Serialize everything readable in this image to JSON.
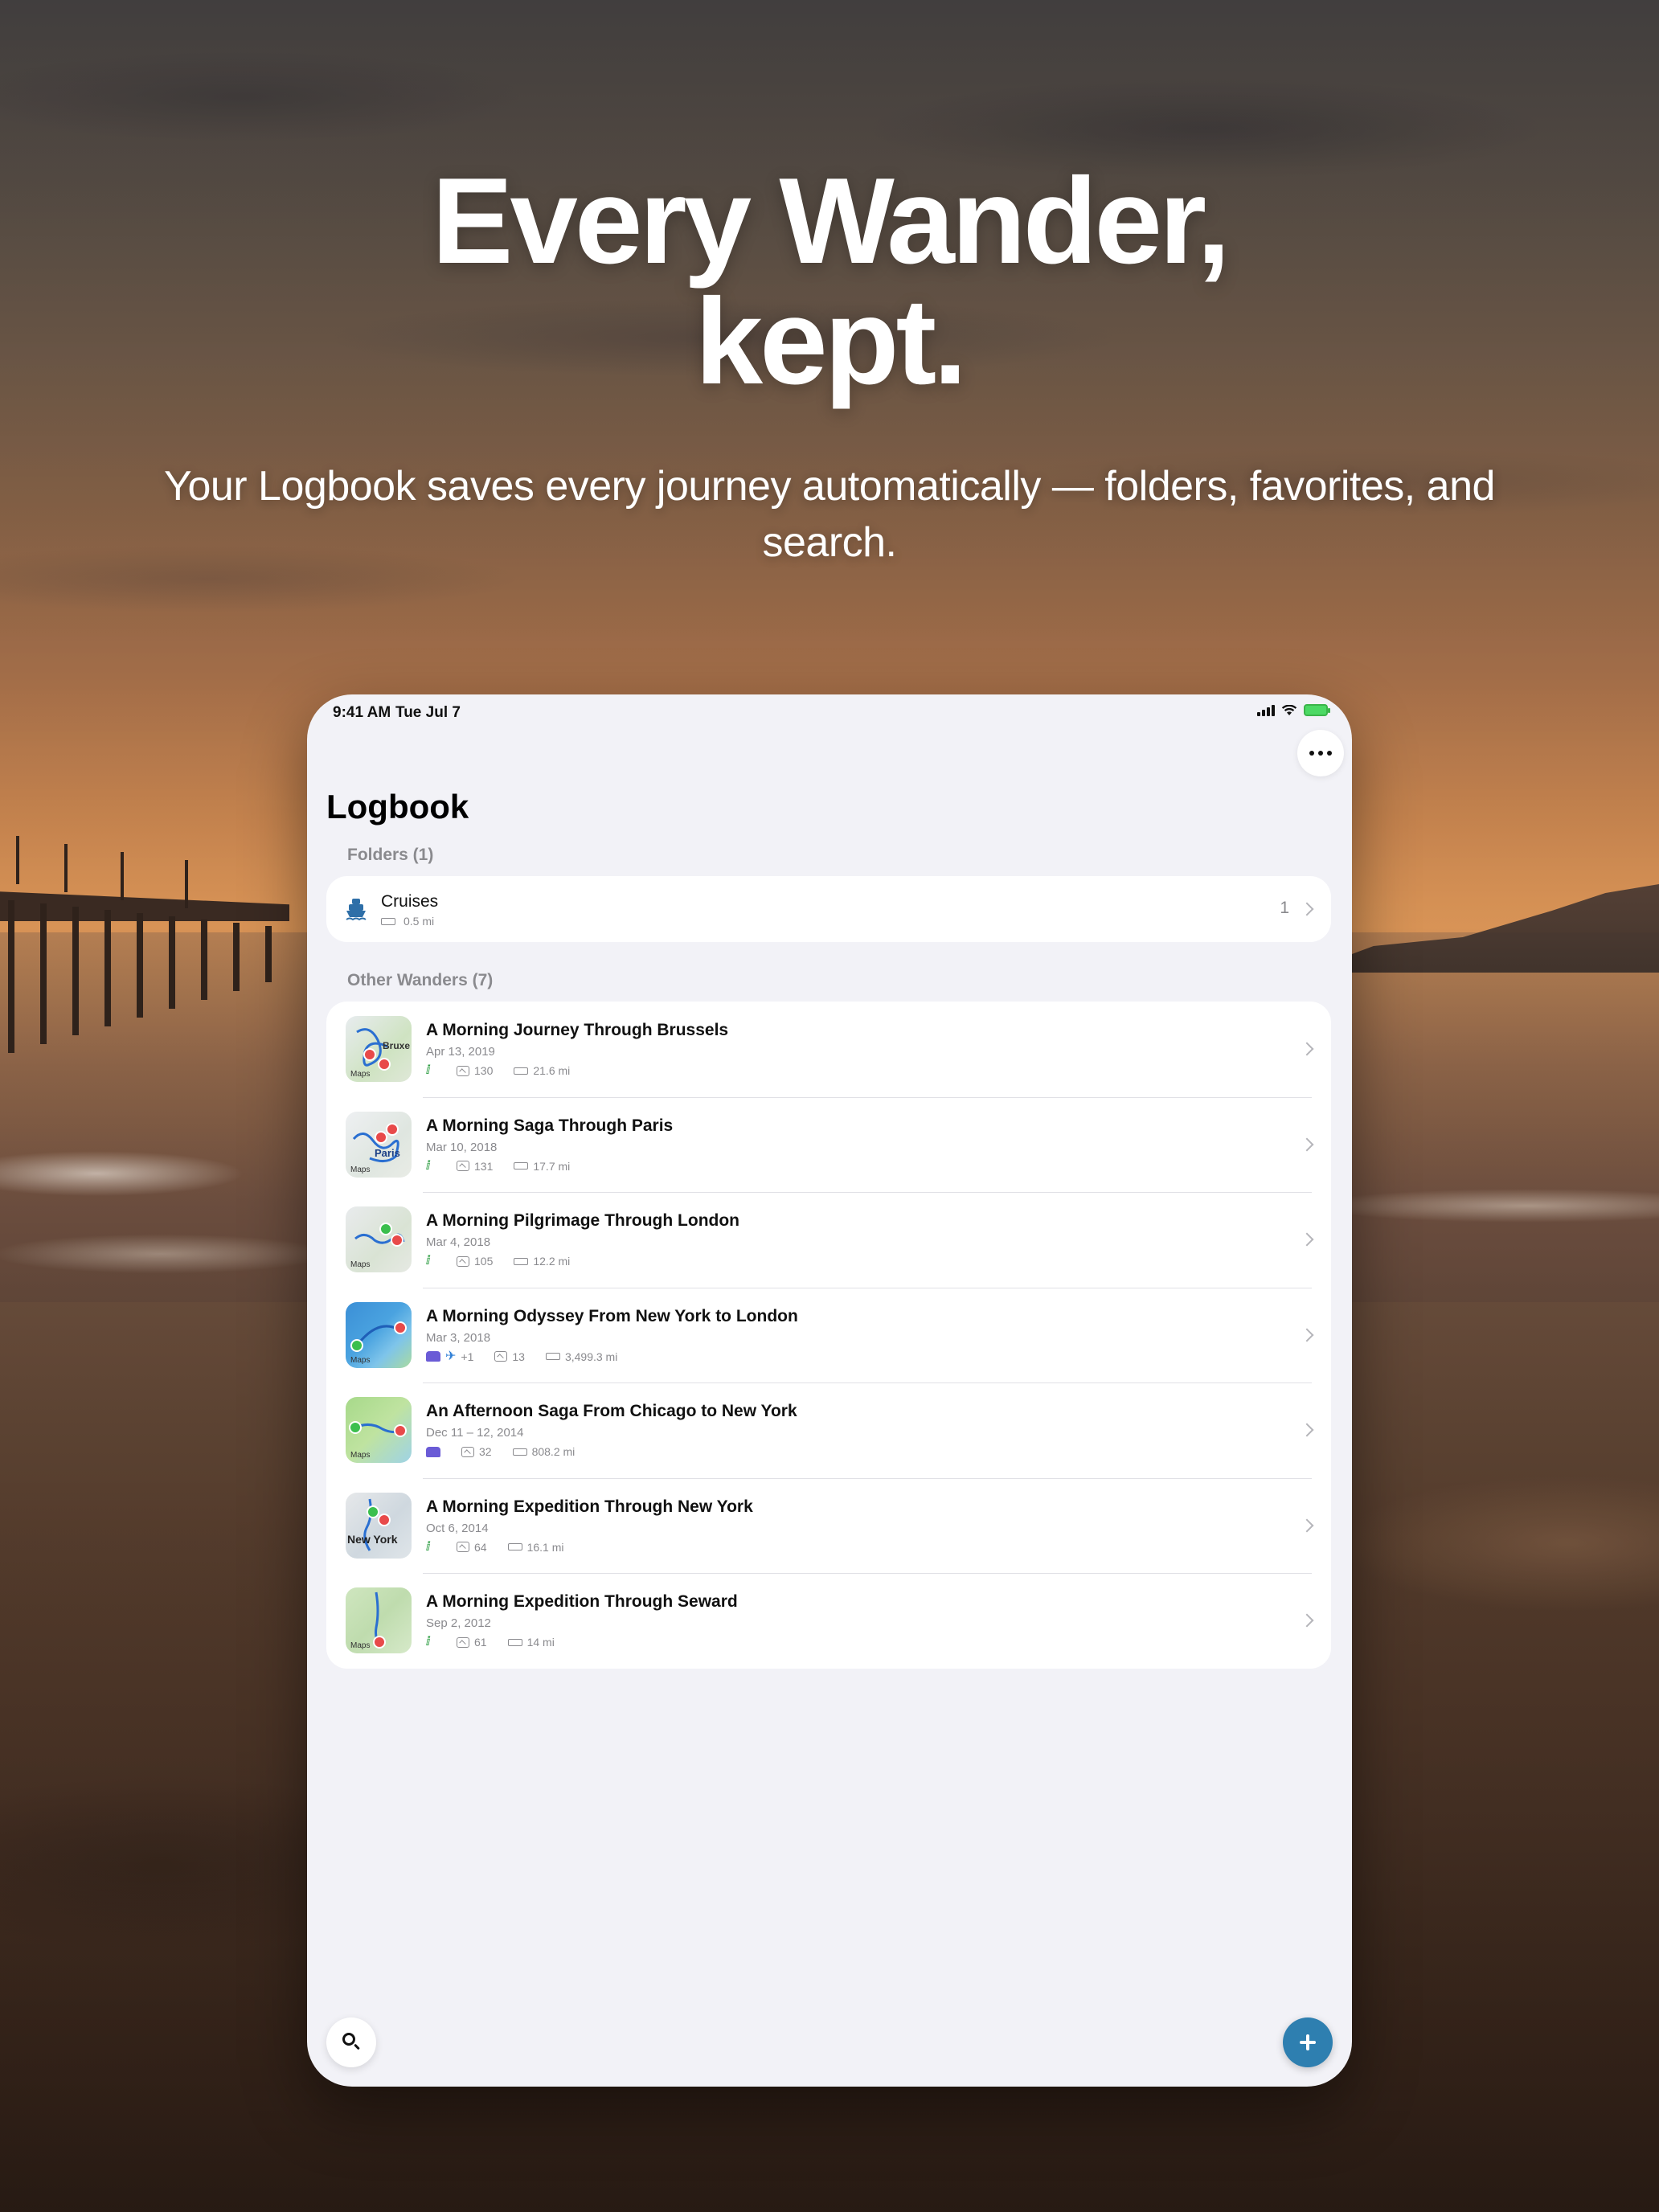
{
  "hero": {
    "title_line1": "Every Wander,",
    "title_line2": "kept.",
    "subtitle": "Your Logbook saves every journey automatically — folders, favorites, and search."
  },
  "status_bar": {
    "time": "9:41 AM",
    "date": "Tue Jul 7",
    "icons": [
      "cellular-signal-icon",
      "wifi-icon",
      "battery-charging-icon"
    ]
  },
  "toolbar": {
    "more_icon": "ellipsis-icon"
  },
  "page": {
    "title": "Logbook"
  },
  "folders": {
    "header": "Folders (1)",
    "items": [
      {
        "name": "Cruises",
        "distance": "0.5 mi",
        "count": "1",
        "icon": "ship-icon"
      }
    ]
  },
  "wanders": {
    "header": "Other Wanders (7)",
    "items": [
      {
        "title": "A Morning Journey Through Brussels",
        "date": "Apr 13, 2019",
        "modes": [
          "walk"
        ],
        "extra": "",
        "photos": "130",
        "distance": "21.6 mi",
        "thumb_label": "Bruxe"
      },
      {
        "title": "A Morning Saga Through Paris",
        "date": "Mar 10, 2018",
        "modes": [
          "walk"
        ],
        "extra": "",
        "photos": "131",
        "distance": "17.7 mi",
        "thumb_label": "Paris"
      },
      {
        "title": "A Morning Pilgrimage Through London",
        "date": "Mar 4, 2018",
        "modes": [
          "walk"
        ],
        "extra": "",
        "photos": "105",
        "distance": "12.2 mi",
        "thumb_label": ""
      },
      {
        "title": "A Morning Odyssey From New York to London",
        "date": "Mar 3, 2018",
        "modes": [
          "car",
          "plane"
        ],
        "extra": "+1",
        "photos": "13",
        "distance": "3,499.3 mi",
        "thumb_label": ""
      },
      {
        "title": "An Afternoon Saga From Chicago to New York",
        "date": "Dec 11 – 12, 2014",
        "modes": [
          "car"
        ],
        "extra": "",
        "photos": "32",
        "distance": "808.2 mi",
        "thumb_label": ""
      },
      {
        "title": "A Morning Expedition Through New York",
        "date": "Oct 6, 2014",
        "modes": [
          "walk"
        ],
        "extra": "",
        "photos": "64",
        "distance": "16.1 mi",
        "thumb_label": "New York"
      },
      {
        "title": "A Morning Expedition Through Seward",
        "date": "Sep 2, 2012",
        "modes": [
          "walk"
        ],
        "extra": "",
        "photos": "61",
        "distance": "14 mi",
        "thumb_label": ""
      }
    ],
    "maps_tag": "Maps"
  },
  "fabs": {
    "search_icon": "search-icon",
    "add_icon": "plus-icon"
  },
  "colors": {
    "accent": "#2e7fb0",
    "walk": "#2f9e44",
    "car": "#6a5bd6",
    "plane": "#2f7fd6",
    "pin_start": "#3bbf4d",
    "pin_end": "#e84a4a"
  }
}
